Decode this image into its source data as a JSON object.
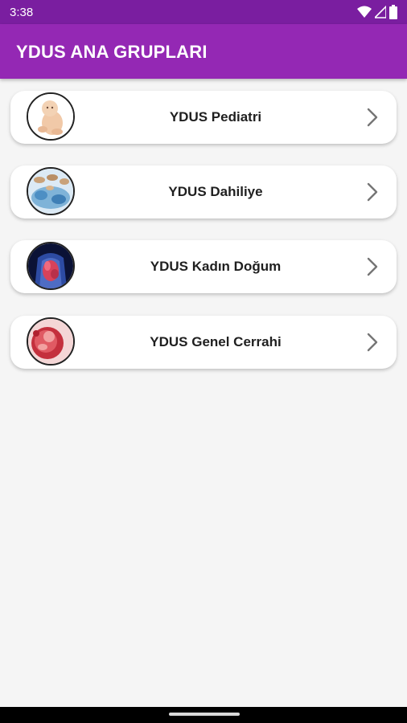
{
  "status_bar": {
    "time": "3:38",
    "icons": [
      "wifi-icon",
      "cell-signal-icon",
      "battery-icon"
    ]
  },
  "app_bar": {
    "title": "YDUS ANA GRUPLARI",
    "color": "#9428b4"
  },
  "groups": [
    {
      "label": "YDUS Pediatri",
      "image": "baby-image"
    },
    {
      "label": "YDUS Dahiliye",
      "image": "cells-image"
    },
    {
      "label": "YDUS Kadın Doğum",
      "image": "anatomy-image"
    },
    {
      "label": "YDUS Genel Cerrahi",
      "image": "fetus-image"
    }
  ],
  "colors": {
    "status_bar": "#7a1ea0",
    "background": "#f5f5f5",
    "card": "#ffffff",
    "chevron": "#757575"
  }
}
